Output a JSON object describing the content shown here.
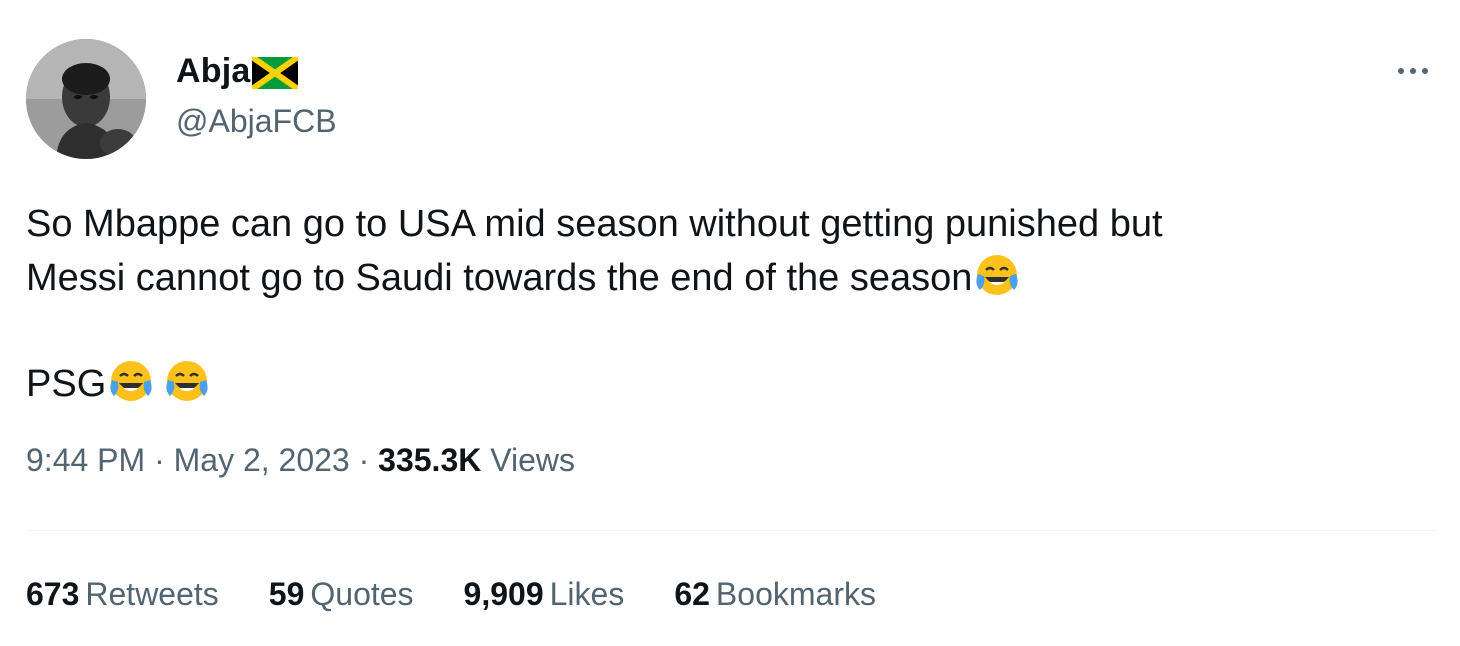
{
  "author": {
    "display_name": "Abja",
    "flag_icon": "jamaica-flag-icon",
    "handle": "@AbjaFCB",
    "avatar_icon": "profile-photo-boxer"
  },
  "menu": {
    "icon": "more-horizontal-icon"
  },
  "tweet": {
    "line1": "So Mbappe can go to USA mid season without getting punished but",
    "line2": "Messi cannot go to Saudi towards the end of the season",
    "line3": "PSG",
    "emoji": "face-with-tears-of-joy-icon"
  },
  "meta": {
    "time": "9:44 PM",
    "sep1": " · ",
    "date": "May 2, 2023",
    "sep2": " · ",
    "views_count": "335.3K",
    "views_label": "Views"
  },
  "stats": [
    {
      "num": "673",
      "label": "Retweets"
    },
    {
      "num": "59",
      "label": "Quotes"
    },
    {
      "num": "9,909",
      "label": "Likes"
    },
    {
      "num": "62",
      "label": "Bookmarks"
    }
  ],
  "colors": {
    "primary_text": "#0f1419",
    "secondary_text": "#536471",
    "divider": "#eff3f4",
    "flag_green": "#009b3a",
    "flag_gold": "#fed100",
    "flag_black": "#000000"
  }
}
